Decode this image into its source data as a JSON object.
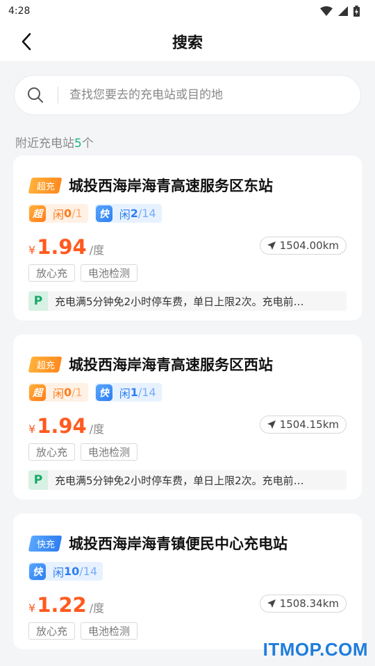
{
  "status": {
    "time": "4:28"
  },
  "header": {
    "title": "搜索"
  },
  "search": {
    "placeholder": "查找您要去的充电站或目的地"
  },
  "nearby": {
    "prefix": "附近充电站",
    "count": "5",
    "suffix": "个"
  },
  "stations": [
    {
      "tag": "超充",
      "tag_type": "super",
      "name": "城投西海岸海青高速服务区东站",
      "slots": [
        {
          "type": "super",
          "badge": "超",
          "label": "闲",
          "free": "0",
          "total": "/1"
        },
        {
          "type": "fast",
          "badge": "快",
          "label": "闲",
          "free": "2",
          "total": "/14"
        }
      ],
      "yen": "¥",
      "price": "1.94",
      "unit": "/度",
      "distance": "1504.00km",
      "features": [
        "放心充",
        "电池检测"
      ],
      "parking_icon": "P",
      "parking": "充电满5分钟免2小时停车费，单日上限2次。充电前…"
    },
    {
      "tag": "超充",
      "tag_type": "super",
      "name": "城投西海岸海青高速服务区西站",
      "slots": [
        {
          "type": "super",
          "badge": "超",
          "label": "闲",
          "free": "0",
          "total": "/1"
        },
        {
          "type": "fast",
          "badge": "快",
          "label": "闲",
          "free": "1",
          "total": "/14"
        }
      ],
      "yen": "¥",
      "price": "1.94",
      "unit": "/度",
      "distance": "1504.15km",
      "features": [
        "放心充",
        "电池检测"
      ],
      "parking_icon": "P",
      "parking": "充电满5分钟免2小时停车费，单日上限2次。充电前…"
    },
    {
      "tag": "快充",
      "tag_type": "fast",
      "name": "城投西海岸海青镇便民中心充电站",
      "slots": [
        {
          "type": "fast",
          "badge": "快",
          "label": "闲",
          "free": "10",
          "total": "/14"
        }
      ],
      "yen": "¥",
      "price": "1.22",
      "unit": "/度",
      "distance": "1508.34km",
      "features": [
        "放心充",
        "电池检测"
      ]
    }
  ],
  "watermark": "ITMOP.COM",
  "colors": {
    "accent_orange": "#ff5a1f",
    "accent_blue": "#2e7ef0",
    "accent_green": "#16b67a"
  }
}
